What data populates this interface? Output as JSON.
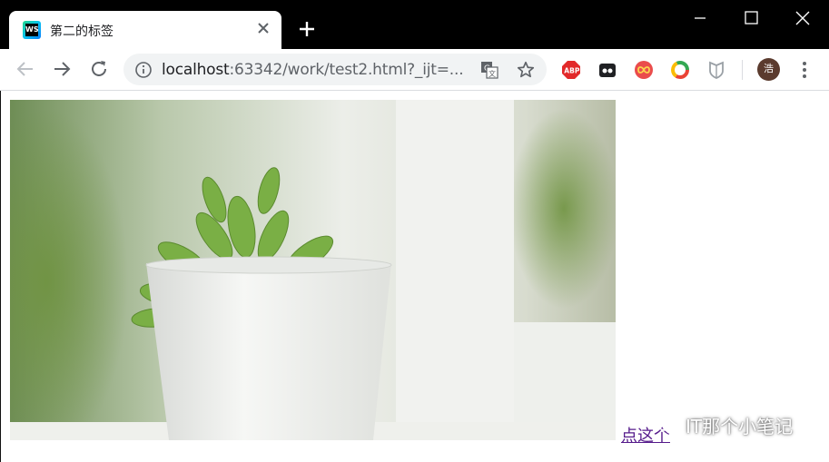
{
  "tab": {
    "title": "第二的标签",
    "favicon_text": "WS"
  },
  "address": {
    "host": "localhost",
    "rest": ":63342/work/test2.html?_ijt=..."
  },
  "extensions": {
    "abp_label": "ABP"
  },
  "profile": {
    "avatar_char": "浩"
  },
  "page": {
    "link_text": "点这个"
  },
  "watermark": {
    "text": "IT那个小笔记"
  }
}
